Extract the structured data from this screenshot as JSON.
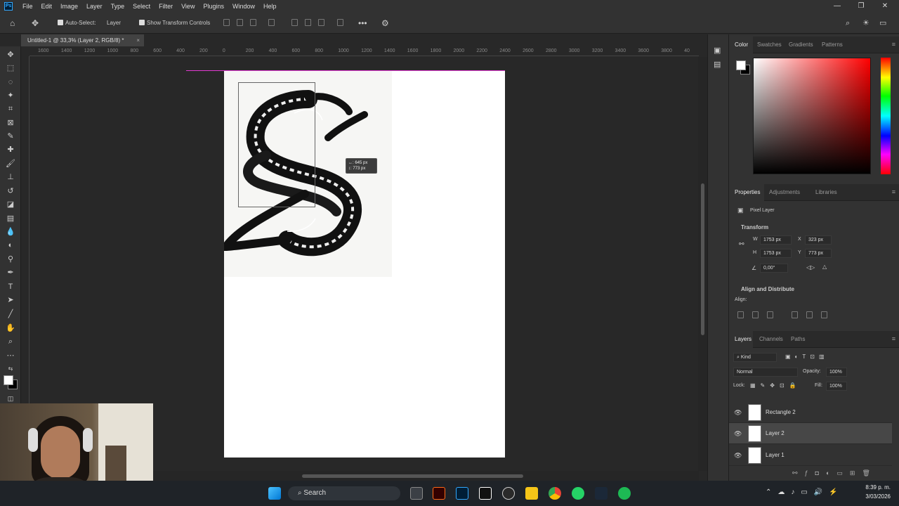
{
  "app": {
    "logo": "Ps"
  },
  "menu": [
    "File",
    "Edit",
    "Image",
    "Layer",
    "Type",
    "Select",
    "Filter",
    "View",
    "Plugins",
    "Window",
    "Help"
  ],
  "window_controls": {
    "minimize": "—",
    "maximize": "❐",
    "close": "✕"
  },
  "options_bar": {
    "auto_select_label": "Auto-Select:",
    "auto_select_value": "Layer",
    "show_transform_label": "Show Transform Controls"
  },
  "document_tab": {
    "title": "Untitled-1 @ 33,3% (Layer 2, RGB/8) *",
    "close": "×"
  },
  "ruler_ticks": [
    "1600",
    "1400",
    "1200",
    "1000",
    "800",
    "600",
    "400",
    "200",
    "0",
    "200",
    "400",
    "600",
    "800",
    "1000",
    "1200",
    "1400",
    "1600",
    "1800",
    "2000",
    "2200",
    "2400",
    "2600",
    "2800",
    "3000",
    "3200",
    "3400",
    "3600",
    "3800",
    "40"
  ],
  "transform_tooltip": {
    "width": "↔: 645 px",
    "height": "↕: 773 px"
  },
  "color_panel": {
    "tabs": [
      "Color",
      "Swatches",
      "Gradients",
      "Patterns"
    ]
  },
  "properties_panel": {
    "tabs": [
      "Properties",
      "Adjustments",
      "Libraries"
    ],
    "layer_type": "Pixel Layer",
    "transform_section": "Transform",
    "w_label": "W",
    "w_value": "1753 px",
    "h_label": "H",
    "h_value": "1753 px",
    "x_label": "X",
    "x_value": "323 px",
    "y_label": "Y",
    "y_value": "773 px",
    "angle_value": "0,00°",
    "align_section": "Align and Distribute",
    "align_label": "Align:"
  },
  "layers_panel": {
    "tabs": [
      "Layers",
      "Channels",
      "Paths"
    ],
    "filter_kind": "Kind",
    "blend_mode": "Normal",
    "opacity_label": "Opacity:",
    "opacity_value": "100%",
    "lock_label": "Lock:",
    "fill_label": "Fill:",
    "fill_value": "100%",
    "layers": [
      {
        "name": "Rectangle 2"
      },
      {
        "name": "Layer 2"
      },
      {
        "name": "Layer 1"
      }
    ]
  },
  "taskbar": {
    "search_label": "Search",
    "time": "8:39 p. m.",
    "date": "3/03/2026"
  },
  "colors": {
    "guide": "#e23ad2",
    "accent": "#31a8ff"
  }
}
